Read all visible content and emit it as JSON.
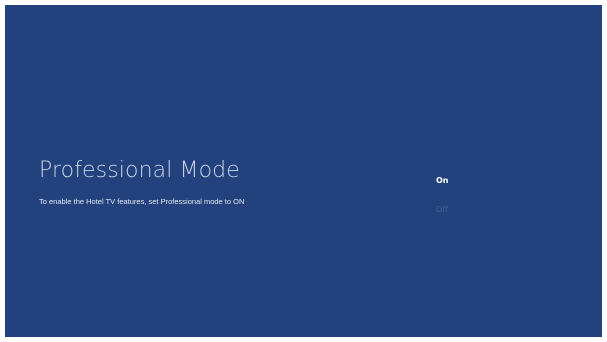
{
  "screen": {
    "background_color": "#23427d"
  },
  "setting": {
    "title": "Professional Mode",
    "description": "To enable the Hotel TV features, set Professional mode to ON"
  },
  "options": {
    "selected": "On",
    "items": [
      {
        "label": "On",
        "selected": true
      },
      {
        "label": "Off",
        "selected": false
      }
    ]
  }
}
